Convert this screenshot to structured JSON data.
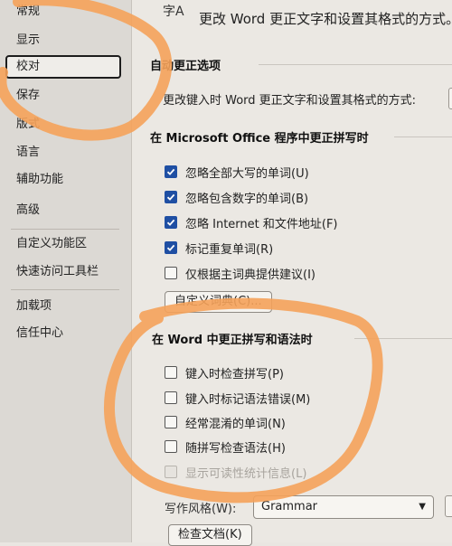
{
  "sidebar": {
    "items": [
      {
        "label": "常规"
      },
      {
        "label": "显示"
      },
      {
        "label": "校对"
      },
      {
        "label": "保存"
      },
      {
        "label": "版式"
      },
      {
        "label": "语言"
      },
      {
        "label": "辅助功能"
      },
      {
        "label": "高级"
      },
      {
        "label": "自定义功能区"
      },
      {
        "label": "快速访问工具栏"
      },
      {
        "label": "加载项"
      },
      {
        "label": "信任中心"
      }
    ],
    "selected_index": 2
  },
  "header": {
    "icon_text": "字A",
    "title": "更改 Word 更正文字和设置其格式的方式。"
  },
  "autocorrect": {
    "heading": "自动更正选项",
    "description": "更改键入时 Word 更正文字和设置其格式的方式:",
    "button_label": ""
  },
  "office_section": {
    "heading": "在 Microsoft Office 程序中更正拼写时",
    "options": [
      {
        "label": "忽略全部大写的单词(U)",
        "checked": true
      },
      {
        "label": "忽略包含数字的单词(B)",
        "checked": true
      },
      {
        "label": "忽略 Internet 和文件地址(F)",
        "checked": true
      },
      {
        "label": "标记重复单词(R)",
        "checked": true
      },
      {
        "label": "仅根据主词典提供建议(I)",
        "checked": false
      }
    ],
    "custom_dict_button": "自定义词典(C)..."
  },
  "word_section": {
    "heading": "在 Word 中更正拼写和语法时",
    "options": [
      {
        "label": "键入时检查拼写(P)",
        "checked": false,
        "disabled": false
      },
      {
        "label": "键入时标记语法错误(M)",
        "checked": false,
        "disabled": false
      },
      {
        "label": "经常混淆的单词(N)",
        "checked": false,
        "disabled": false
      },
      {
        "label": "随拼写检查语法(H)",
        "checked": false,
        "disabled": false
      },
      {
        "label": "显示可读性统计信息(L)",
        "checked": false,
        "disabled": true
      }
    ],
    "writing_style_label": "写作风格(W):",
    "writing_style_value": "Grammar",
    "recheck_button": "检查文档(K)"
  },
  "colors": {
    "accent": "#1f4fa3",
    "marker": "#f5a25a"
  }
}
